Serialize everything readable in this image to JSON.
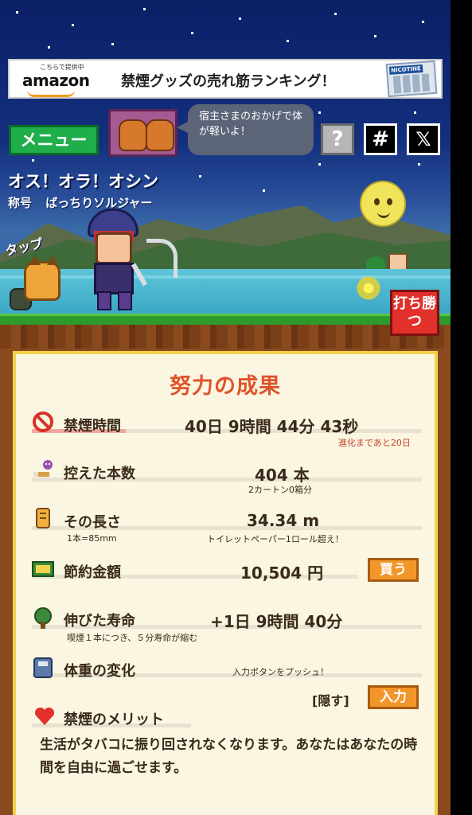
{
  "ad": {
    "small_text": "こちらで提供中",
    "brand": "amazon",
    "headline": "禁煙グッズの売れ筋ランキング！",
    "pack_label": "NICOTINE"
  },
  "header": {
    "menu_label": "メニュー",
    "speech": "宿主さまのおかげで体が軽いよ！",
    "help_label": "?",
    "hash_label": "#",
    "x_label": "𝕏"
  },
  "player": {
    "greeting": "オス！オラ！オシン",
    "title_label": "称号",
    "title_value": "ばっちりソルジャー"
  },
  "scene": {
    "tap_label": "タップ",
    "fight_label": "打ち勝つ"
  },
  "results": {
    "title": "努力の成果",
    "quit_time": {
      "label": "禁煙時間",
      "value": "40日  9時間  44分  43秒",
      "note": "進化まであと20日",
      "progress": 0.67
    },
    "cigarettes": {
      "label": "控えた本数",
      "value": "404 本",
      "note": "2カートン0箱分"
    },
    "length": {
      "label": "その長さ",
      "value": "34.34 m",
      "per": "1本=85mm",
      "note": "トイレットペーパー1ロール超え！"
    },
    "money": {
      "label": "節約金額",
      "value": "10,504 円",
      "button": "買う"
    },
    "life": {
      "label": "伸びた寿命",
      "value": "+1日  9時間  40分",
      "note": "喫煙１本につき、５分寿命が縮む"
    },
    "weight": {
      "label": "体重の変化",
      "note": "入力ボタンをプッシュ！",
      "hide": "[隠す]",
      "button": "入力"
    },
    "merit": {
      "label": "禁煙のメリット",
      "text": "生活がタバコに振り回されなくなります。あなたはあなたの時間を自由に過ごせます。"
    }
  },
  "colors": {
    "accent": "#e0532a",
    "button": "#f3962a",
    "menu": "#1fae4a",
    "panel": "#faf6e2"
  }
}
